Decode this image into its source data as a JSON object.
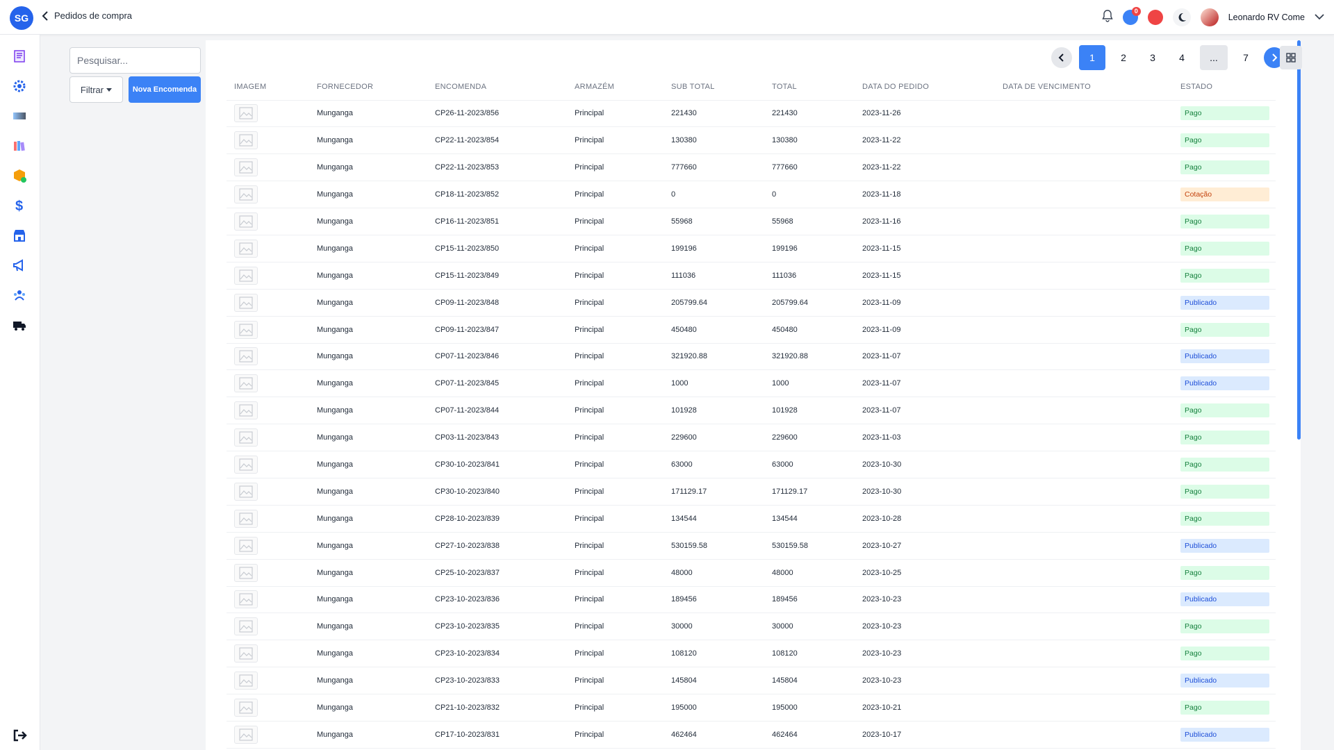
{
  "app": {
    "logo": "SG"
  },
  "header": {
    "back_label": "Pedidos de compra",
    "notification_count": "0",
    "user_name": "Leonardo RV Come"
  },
  "sidebar": {
    "items": [
      {
        "icon": "receipt-icon"
      },
      {
        "icon": "gear-icon"
      },
      {
        "icon": "gradient-card-icon"
      },
      {
        "icon": "books-icon"
      },
      {
        "icon": "box-icon"
      },
      {
        "icon": "dollar-icon"
      },
      {
        "icon": "store-icon"
      },
      {
        "icon": "megaphone-icon"
      },
      {
        "icon": "users-icon"
      },
      {
        "icon": "truck-icon"
      }
    ],
    "logout_icon": "logout-icon"
  },
  "filters": {
    "search_placeholder": "Pesquisar...",
    "filter_label": "Filtrar",
    "new_order_label": "Nova Encomenda"
  },
  "pagination": {
    "pages": [
      "1",
      "2",
      "3",
      "4",
      "...",
      "7"
    ],
    "current": "1"
  },
  "table": {
    "columns": [
      "IMAGEM",
      "FORNECEDOR",
      "ENCOMENDA",
      "ARMAZÉM",
      "SUB TOTAL",
      "TOTAL",
      "DATA DO PEDIDO",
      "DATA DE VENCIMENTO",
      "ESTADO"
    ],
    "rows": [
      {
        "fornecedor": "Munganga",
        "encomenda": "CP26-11-2023/856",
        "armazem": "Principal",
        "subtotal": "221430",
        "total": "221430",
        "data": "2023-11-26",
        "vencimento": "",
        "estado": "Pago"
      },
      {
        "fornecedor": "Munganga",
        "encomenda": "CP22-11-2023/854",
        "armazem": "Principal",
        "subtotal": "130380",
        "total": "130380",
        "data": "2023-11-22",
        "vencimento": "",
        "estado": "Pago"
      },
      {
        "fornecedor": "Munganga",
        "encomenda": "CP22-11-2023/853",
        "armazem": "Principal",
        "subtotal": "777660",
        "total": "777660",
        "data": "2023-11-22",
        "vencimento": "",
        "estado": "Pago"
      },
      {
        "fornecedor": "Munganga",
        "encomenda": "CP18-11-2023/852",
        "armazem": "Principal",
        "subtotal": "0",
        "total": "0",
        "data": "2023-11-18",
        "vencimento": "",
        "estado": "Cotação"
      },
      {
        "fornecedor": "Munganga",
        "encomenda": "CP16-11-2023/851",
        "armazem": "Principal",
        "subtotal": "55968",
        "total": "55968",
        "data": "2023-11-16",
        "vencimento": "",
        "estado": "Pago"
      },
      {
        "fornecedor": "Munganga",
        "encomenda": "CP15-11-2023/850",
        "armazem": "Principal",
        "subtotal": "199196",
        "total": "199196",
        "data": "2023-11-15",
        "vencimento": "",
        "estado": "Pago"
      },
      {
        "fornecedor": "Munganga",
        "encomenda": "CP15-11-2023/849",
        "armazem": "Principal",
        "subtotal": "111036",
        "total": "111036",
        "data": "2023-11-15",
        "vencimento": "",
        "estado": "Pago"
      },
      {
        "fornecedor": "Munganga",
        "encomenda": "CP09-11-2023/848",
        "armazem": "Principal",
        "subtotal": "205799.64",
        "total": "205799.64",
        "data": "2023-11-09",
        "vencimento": "",
        "estado": "Publicado"
      },
      {
        "fornecedor": "Munganga",
        "encomenda": "CP09-11-2023/847",
        "armazem": "Principal",
        "subtotal": "450480",
        "total": "450480",
        "data": "2023-11-09",
        "vencimento": "",
        "estado": "Pago"
      },
      {
        "fornecedor": "Munganga",
        "encomenda": "CP07-11-2023/846",
        "armazem": "Principal",
        "subtotal": "321920.88",
        "total": "321920.88",
        "data": "2023-11-07",
        "vencimento": "",
        "estado": "Publicado"
      },
      {
        "fornecedor": "Munganga",
        "encomenda": "CP07-11-2023/845",
        "armazem": "Principal",
        "subtotal": "1000",
        "total": "1000",
        "data": "2023-11-07",
        "vencimento": "",
        "estado": "Publicado"
      },
      {
        "fornecedor": "Munganga",
        "encomenda": "CP07-11-2023/844",
        "armazem": "Principal",
        "subtotal": "101928",
        "total": "101928",
        "data": "2023-11-07",
        "vencimento": "",
        "estado": "Pago"
      },
      {
        "fornecedor": "Munganga",
        "encomenda": "CP03-11-2023/843",
        "armazem": "Principal",
        "subtotal": "229600",
        "total": "229600",
        "data": "2023-11-03",
        "vencimento": "",
        "estado": "Pago"
      },
      {
        "fornecedor": "Munganga",
        "encomenda": "CP30-10-2023/841",
        "armazem": "Principal",
        "subtotal": "63000",
        "total": "63000",
        "data": "2023-10-30",
        "vencimento": "",
        "estado": "Pago"
      },
      {
        "fornecedor": "Munganga",
        "encomenda": "CP30-10-2023/840",
        "armazem": "Principal",
        "subtotal": "171129.17",
        "total": "171129.17",
        "data": "2023-10-30",
        "vencimento": "",
        "estado": "Pago"
      },
      {
        "fornecedor": "Munganga",
        "encomenda": "CP28-10-2023/839",
        "armazem": "Principal",
        "subtotal": "134544",
        "total": "134544",
        "data": "2023-10-28",
        "vencimento": "",
        "estado": "Pago"
      },
      {
        "fornecedor": "Munganga",
        "encomenda": "CP27-10-2023/838",
        "armazem": "Principal",
        "subtotal": "530159.58",
        "total": "530159.58",
        "data": "2023-10-27",
        "vencimento": "",
        "estado": "Publicado"
      },
      {
        "fornecedor": "Munganga",
        "encomenda": "CP25-10-2023/837",
        "armazem": "Principal",
        "subtotal": "48000",
        "total": "48000",
        "data": "2023-10-25",
        "vencimento": "",
        "estado": "Pago"
      },
      {
        "fornecedor": "Munganga",
        "encomenda": "CP23-10-2023/836",
        "armazem": "Principal",
        "subtotal": "189456",
        "total": "189456",
        "data": "2023-10-23",
        "vencimento": "",
        "estado": "Publicado"
      },
      {
        "fornecedor": "Munganga",
        "encomenda": "CP23-10-2023/835",
        "armazem": "Principal",
        "subtotal": "30000",
        "total": "30000",
        "data": "2023-10-23",
        "vencimento": "",
        "estado": "Pago"
      },
      {
        "fornecedor": "Munganga",
        "encomenda": "CP23-10-2023/834",
        "armazem": "Principal",
        "subtotal": "108120",
        "total": "108120",
        "data": "2023-10-23",
        "vencimento": "",
        "estado": "Pago"
      },
      {
        "fornecedor": "Munganga",
        "encomenda": "CP23-10-2023/833",
        "armazem": "Principal",
        "subtotal": "145804",
        "total": "145804",
        "data": "2023-10-23",
        "vencimento": "",
        "estado": "Publicado"
      },
      {
        "fornecedor": "Munganga",
        "encomenda": "CP21-10-2023/832",
        "armazem": "Principal",
        "subtotal": "195000",
        "total": "195000",
        "data": "2023-10-21",
        "vencimento": "",
        "estado": "Pago"
      },
      {
        "fornecedor": "Munganga",
        "encomenda": "CP17-10-2023/831",
        "armazem": "Principal",
        "subtotal": "462464",
        "total": "462464",
        "data": "2023-10-17",
        "vencimento": "",
        "estado": "Publicado"
      }
    ]
  },
  "colors": {
    "accent": "#3b82f6",
    "pago": "#dcfce7",
    "cotacao": "#ffedd5",
    "publicado": "#dbeafe",
    "danger": "#ef4444"
  }
}
